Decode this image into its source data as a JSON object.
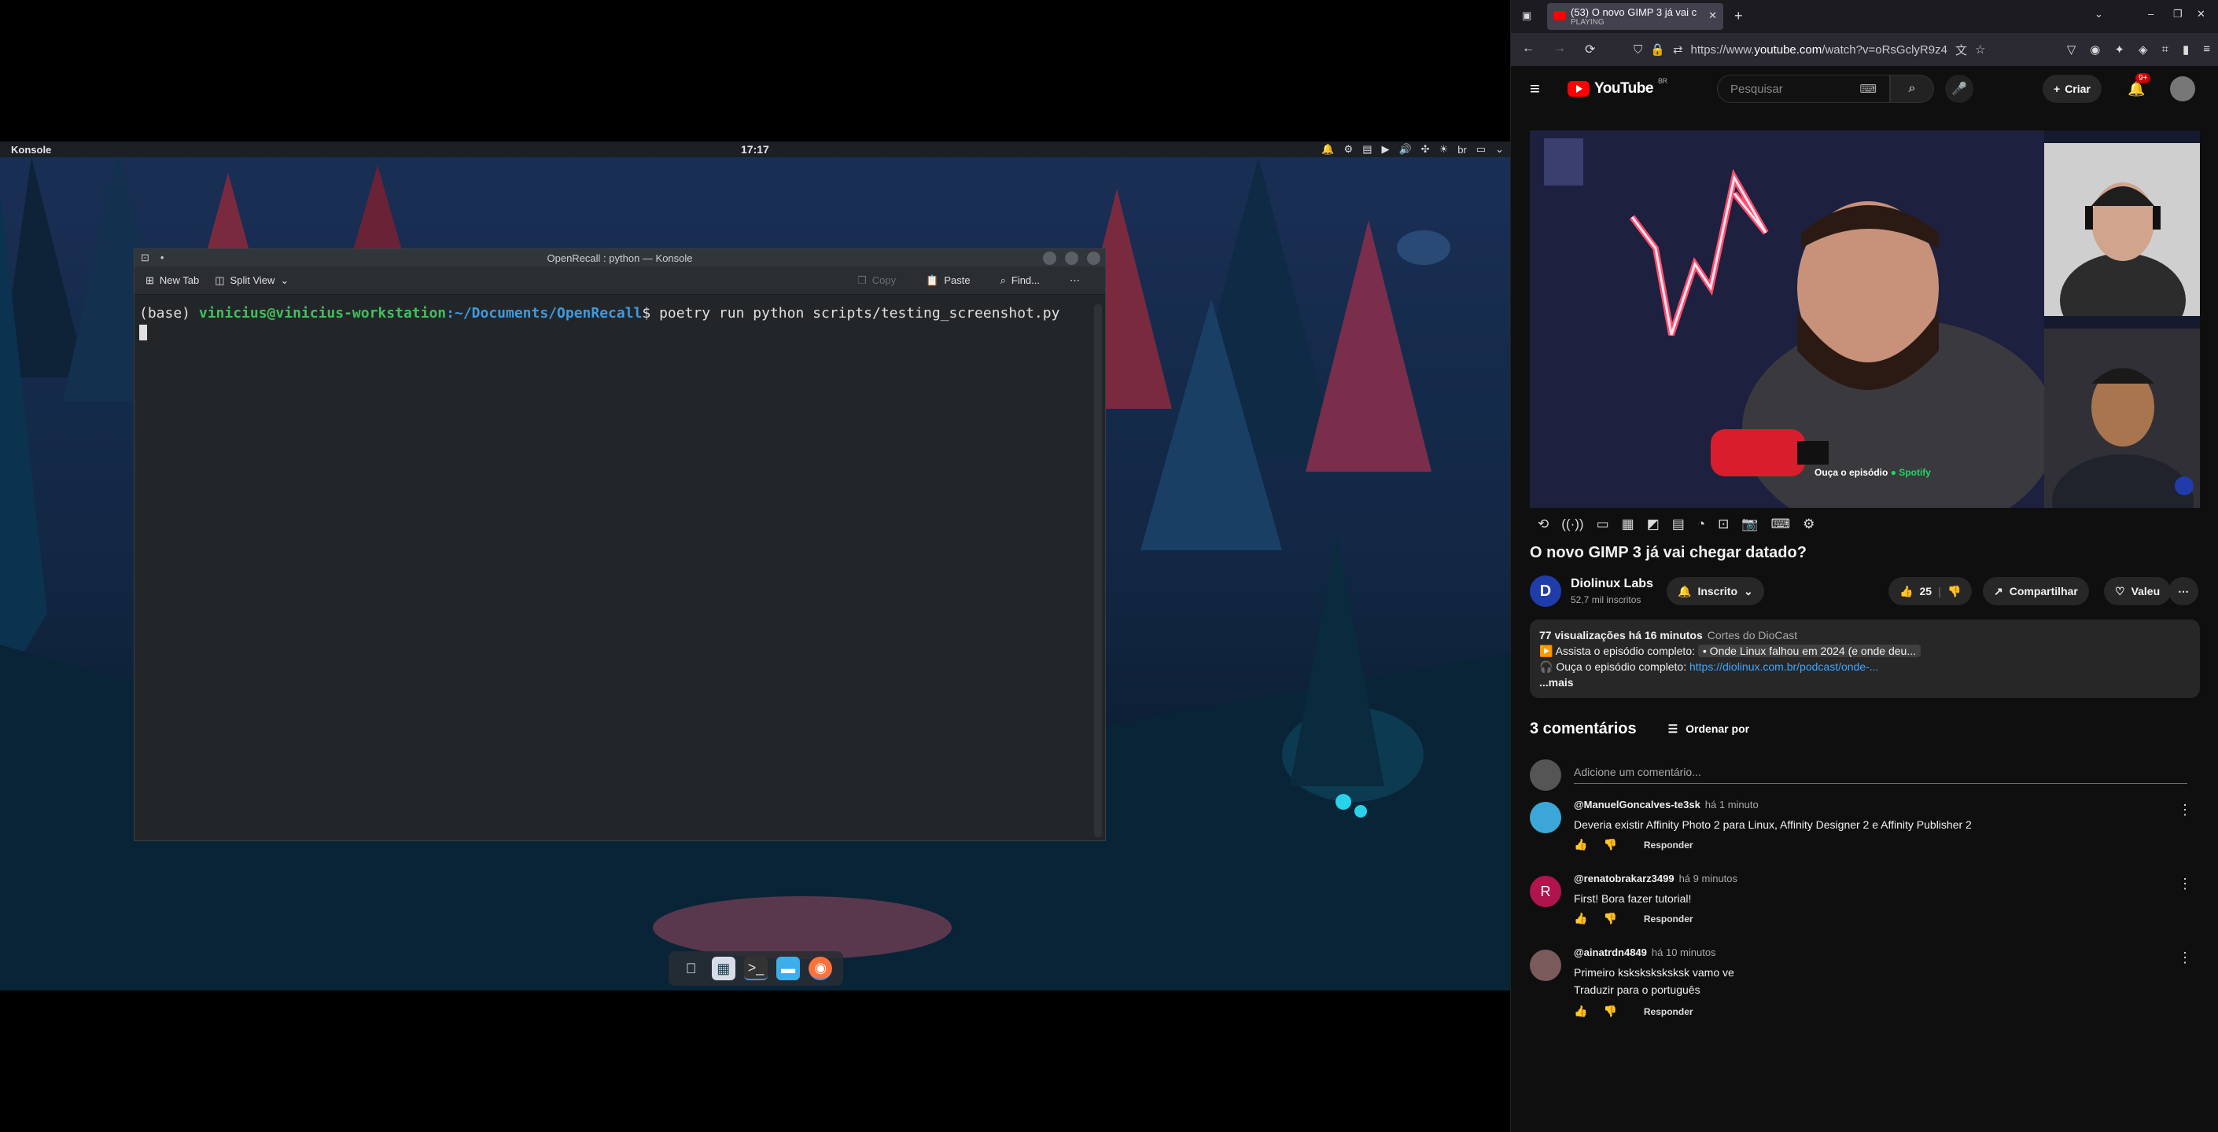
{
  "desktop": {
    "topbar": {
      "app": "Konsole",
      "clock": "17:17",
      "keyboard": "br"
    },
    "dock": {
      "items": [
        "finder",
        "launcher",
        "terminal",
        "files",
        "firefox"
      ]
    }
  },
  "konsole": {
    "window_title": "OpenRecall : python — Konsole",
    "toolbar": {
      "new_tab": "New Tab",
      "split_view": "Split View",
      "copy": "Copy",
      "paste": "Paste",
      "find": "Find..."
    },
    "prompt_prefix": "(base) ",
    "user_host": "vinicius@vinicius-workstation",
    "path": ":~/Documents/OpenRecall",
    "command": "$ poetry run python scripts/testing_screenshot.py"
  },
  "browser": {
    "tab": {
      "title": "(53) O novo GIMP 3 já vai c",
      "status": "PLAYING"
    },
    "url_prefix": "https://www.",
    "url_domain": "youtube.com",
    "url_rest": "/watch?v=oRsGclyR9z4"
  },
  "youtube": {
    "logo": "YouTube",
    "region": "BR",
    "search_placeholder": "Pesquisar",
    "create": "Criar",
    "notif_badge": "9+",
    "spotify_overlay": "Ouça o episódio",
    "spotify_brand": "Spotify",
    "video_title": "O novo GIMP 3 já vai chegar datado?",
    "channel": {
      "name": "Diolinux Labs",
      "subs": "52,7 mil inscritos",
      "initial": "D"
    },
    "subscribed": "Inscrito",
    "likes": "25",
    "share": "Compartilhar",
    "thanks": "Valeu",
    "description": {
      "views": "77 visualizações",
      "age": "há 16 minutos",
      "tags": "Cortes do DioCast",
      "line1": "Assista o episódio completo:",
      "line1_chip": "• Onde Linux falhou em 2024 (e onde deu...",
      "line2": "Ouça o episódio completo:",
      "line2_link": "https://diolinux.com.br/podcast/onde-...",
      "more": "...mais"
    },
    "comments": {
      "count": "3 comentários",
      "sort": "Ordenar por",
      "add_placeholder": "Adicione um comentário...",
      "reply": "Responder",
      "items": [
        {
          "author": "@ManuelGoncalves-te3sk",
          "time": "há 1 minuto",
          "text": "Deveria existir Affinity Photo 2 para Linux, Affinity Designer 2 e Affinity Publisher 2",
          "text2": "",
          "initial": "",
          "color": "#3aa7d8"
        },
        {
          "author": "@renatobrakarz3499",
          "time": "há 9 minutos",
          "text": "First! Bora fazer tutorial!",
          "text2": "",
          "initial": "R",
          "color": "#b0144c"
        },
        {
          "author": "@ainatrdn4849",
          "time": "há 10 minutos",
          "text": "Primeiro ksksksksksksk vamo ve",
          "text2": "Traduzir para o português",
          "initial": "",
          "color": "#7a5a5a"
        }
      ]
    }
  }
}
